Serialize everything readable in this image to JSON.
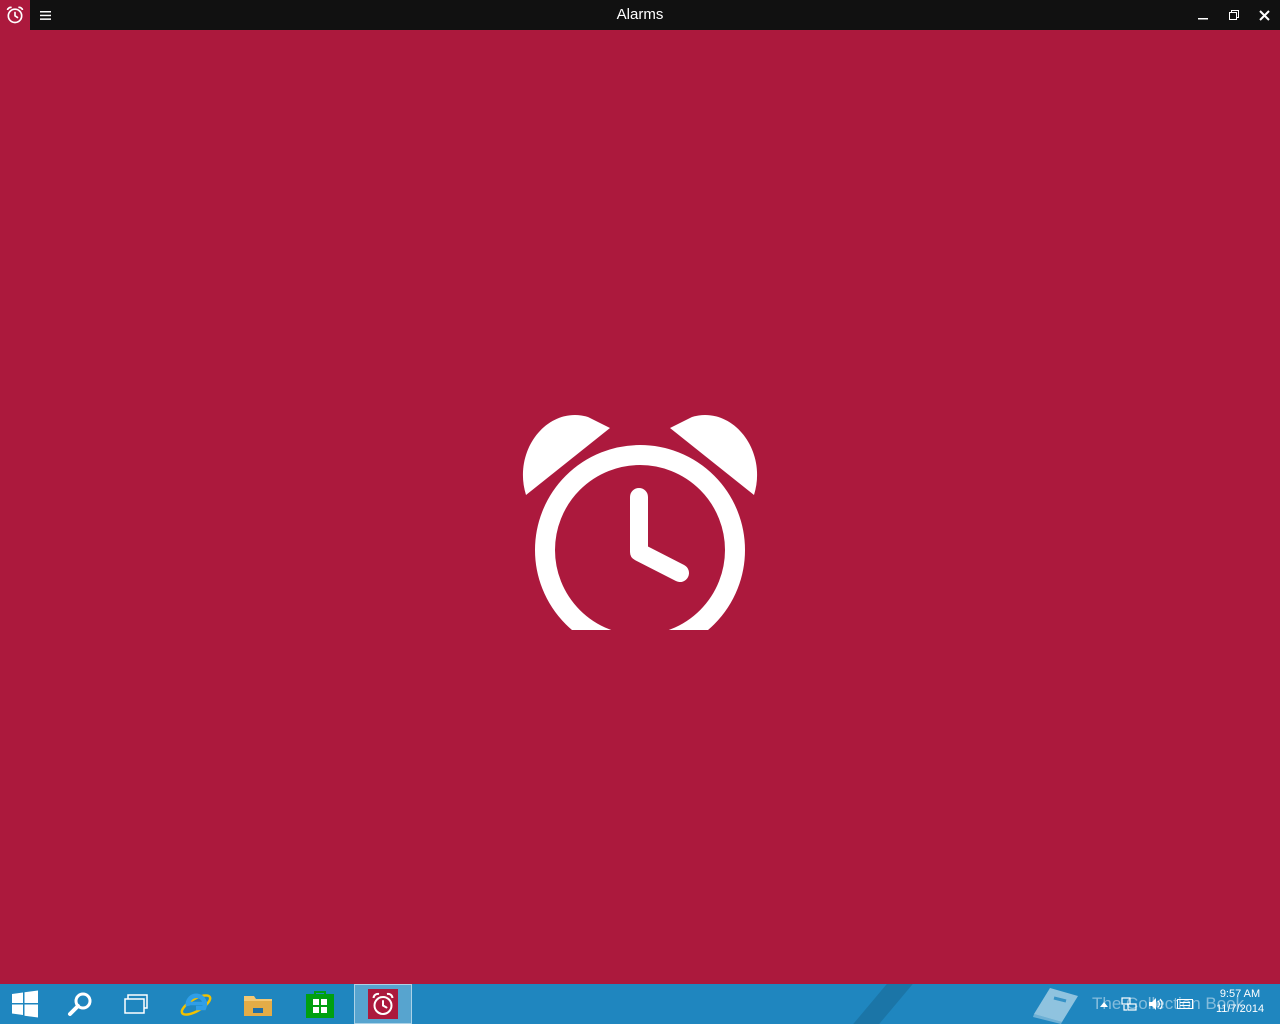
{
  "window": {
    "title": "Alarms",
    "app_icon": "alarm-clock-icon",
    "menu_icon": "hamburger-menu-icon",
    "controls": [
      "minimize-icon",
      "restore-icon",
      "close-icon"
    ]
  },
  "splash": {
    "background": "#ac193d",
    "icon": "alarm-clock-icon",
    "icon_color": "#ffffff"
  },
  "taskbar": {
    "background": "#1f86bf",
    "pinned": [
      {
        "name": "start",
        "icon": "windows-logo-icon"
      },
      {
        "name": "search",
        "icon": "search-icon"
      },
      {
        "name": "task-view",
        "icon": "task-view-icon"
      },
      {
        "name": "internet-explorer",
        "icon": "internet-explorer-icon"
      },
      {
        "name": "file-explorer",
        "icon": "folder-icon"
      },
      {
        "name": "store",
        "icon": "store-bag-icon"
      },
      {
        "name": "alarms",
        "icon": "alarm-clock-icon",
        "active": true
      }
    ],
    "watermark": "The Collection Book",
    "tray": {
      "icons": [
        "show-hidden-icons-chevron",
        "network-icon",
        "volume-icon",
        "keyboard-icon"
      ],
      "time": "9:57 AM",
      "date": "11/7/2014"
    }
  }
}
